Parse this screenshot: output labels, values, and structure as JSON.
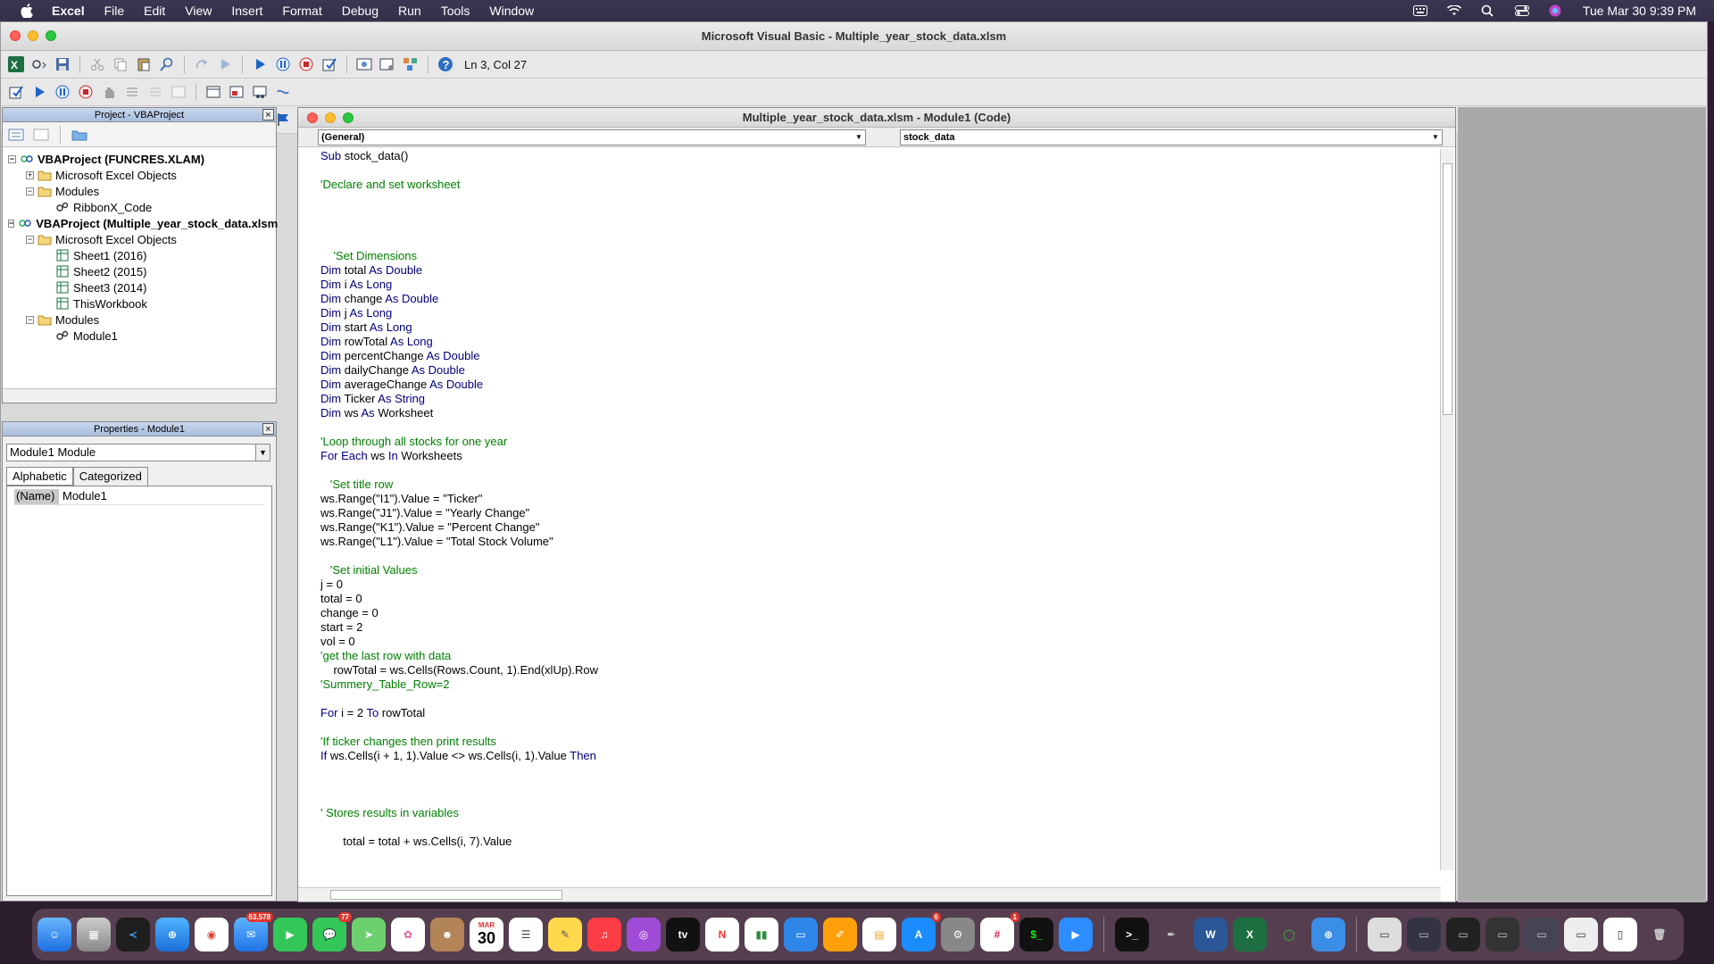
{
  "menubar": {
    "app": "Excel",
    "items": [
      "File",
      "Edit",
      "View",
      "Insert",
      "Format",
      "Debug",
      "Run",
      "Tools",
      "Window"
    ],
    "datetime": "Tue Mar 30  9:39 PM"
  },
  "vbe": {
    "title": "Microsoft Visual Basic - Multiple_year_stock_data.xlsm",
    "status": "Ln 3, Col 27"
  },
  "project": {
    "title": "Project - VBAProject",
    "tree": [
      {
        "label": "VBAProject (FUNCRES.XLAM)",
        "level": 0,
        "bold": true,
        "exp": "−"
      },
      {
        "label": "Microsoft Excel Objects",
        "level": 1,
        "exp": "+"
      },
      {
        "label": "Modules",
        "level": 1,
        "exp": "−"
      },
      {
        "label": "RibbonX_Code",
        "level": 2
      },
      {
        "label": "VBAProject (Multiple_year_stock_data.xlsm",
        "level": 0,
        "bold": true,
        "exp": "−"
      },
      {
        "label": "Microsoft Excel Objects",
        "level": 1,
        "exp": "−"
      },
      {
        "label": "Sheet1 (2016)",
        "level": 2
      },
      {
        "label": "Sheet2 (2015)",
        "level": 2
      },
      {
        "label": "Sheet3 (2014)",
        "level": 2
      },
      {
        "label": "ThisWorkbook",
        "level": 2
      },
      {
        "label": "Modules",
        "level": 1,
        "exp": "−"
      },
      {
        "label": "Module1",
        "level": 2
      }
    ]
  },
  "properties": {
    "title": "Properties - Module1",
    "object": "Module1 Module",
    "tab_alpha": "Alphabetic",
    "tab_cat": "Categorized",
    "prop_name": "(Name)",
    "prop_value": "Module1"
  },
  "code": {
    "title": "Multiple_year_stock_data.xlsm - Module1 (Code)",
    "general": "(General)",
    "proc": "stock_data",
    "lines": [
      [
        [
          "kw",
          "Sub "
        ],
        [
          "",
          "stock_data()"
        ]
      ],
      [],
      [
        [
          "cm",
          "'Declare and set worksheet"
        ]
      ],
      [],
      [],
      [],
      [],
      [
        [
          "cm",
          "    'Set Dimensions"
        ]
      ],
      [
        [
          "kw",
          "Dim "
        ],
        [
          "",
          "total "
        ],
        [
          "kw",
          "As Double"
        ]
      ],
      [
        [
          "kw",
          "Dim "
        ],
        [
          "",
          "i "
        ],
        [
          "kw",
          "As Long"
        ]
      ],
      [
        [
          "kw",
          "Dim "
        ],
        [
          "",
          "change "
        ],
        [
          "kw",
          "As Double"
        ]
      ],
      [
        [
          "kw",
          "Dim "
        ],
        [
          "",
          "j "
        ],
        [
          "kw",
          "As Long"
        ]
      ],
      [
        [
          "kw",
          "Dim "
        ],
        [
          "",
          "start "
        ],
        [
          "kw",
          "As Long"
        ]
      ],
      [
        [
          "kw",
          "Dim "
        ],
        [
          "",
          "rowTotal "
        ],
        [
          "kw",
          "As Long"
        ]
      ],
      [
        [
          "kw",
          "Dim "
        ],
        [
          "",
          "percentChange "
        ],
        [
          "kw",
          "As Double"
        ]
      ],
      [
        [
          "kw",
          "Dim "
        ],
        [
          "",
          "dailyChange "
        ],
        [
          "kw",
          "As Double"
        ]
      ],
      [
        [
          "kw",
          "Dim "
        ],
        [
          "",
          "averageChange "
        ],
        [
          "kw",
          "As Double"
        ]
      ],
      [
        [
          "kw",
          "Dim "
        ],
        [
          "",
          "Ticker "
        ],
        [
          "kw",
          "As String"
        ]
      ],
      [
        [
          "kw",
          "Dim "
        ],
        [
          "",
          "ws "
        ],
        [
          "kw",
          "As "
        ],
        [
          "",
          "Worksheet"
        ]
      ],
      [],
      [
        [
          "cm",
          "'Loop through all stocks for one year"
        ]
      ],
      [
        [
          "kw",
          "For Each "
        ],
        [
          "",
          "ws "
        ],
        [
          "kw",
          "In "
        ],
        [
          "",
          "Worksheets"
        ]
      ],
      [],
      [
        [
          "cm",
          "   'Set title row"
        ]
      ],
      [
        [
          "",
          "ws.Range(\"I1\").Value = \"Ticker\""
        ]
      ],
      [
        [
          "",
          "ws.Range(\"J1\").Value = \"Yearly Change\""
        ]
      ],
      [
        [
          "",
          "ws.Range(\"K1\").Value = \"Percent Change\""
        ]
      ],
      [
        [
          "",
          "ws.Range(\"L1\").Value = \"Total Stock Volume\""
        ]
      ],
      [],
      [
        [
          "cm",
          "   'Set initial Values"
        ]
      ],
      [
        [
          "",
          "j = 0"
        ]
      ],
      [
        [
          "",
          "total = 0"
        ]
      ],
      [
        [
          "",
          "change = 0"
        ]
      ],
      [
        [
          "",
          "start = 2"
        ]
      ],
      [
        [
          "",
          "vol = 0"
        ]
      ],
      [
        [
          "cm",
          "'get the last row with data"
        ]
      ],
      [
        [
          "",
          "    rowTotal = ws.Cells(Rows.Count, 1).End(xlUp).Row"
        ]
      ],
      [
        [
          "cm",
          "'Summery_Table_Row=2"
        ]
      ],
      [],
      [
        [
          "kw",
          "For "
        ],
        [
          "",
          "i = 2 "
        ],
        [
          "kw",
          "To "
        ],
        [
          "",
          "rowTotal"
        ]
      ],
      [],
      [
        [
          "cm",
          "'If ticker changes then print results"
        ]
      ],
      [
        [
          "kw",
          "If "
        ],
        [
          "",
          "ws.Cells(i + 1, 1).Value <> ws.Cells(i, 1).Value "
        ],
        [
          "kw",
          "Then"
        ]
      ],
      [],
      [],
      [],
      [
        [
          "cm",
          "' Stores results in variables"
        ]
      ],
      [],
      [
        [
          "",
          "       total = total + ws.Cells(i, 7).Value"
        ]
      ]
    ]
  },
  "dock": {
    "mail_badge": "63,578",
    "messages_badge": "77",
    "appstore_badge": "6",
    "slack_badge": "1",
    "calendar_month": "MAR",
    "calendar_day": "30"
  }
}
